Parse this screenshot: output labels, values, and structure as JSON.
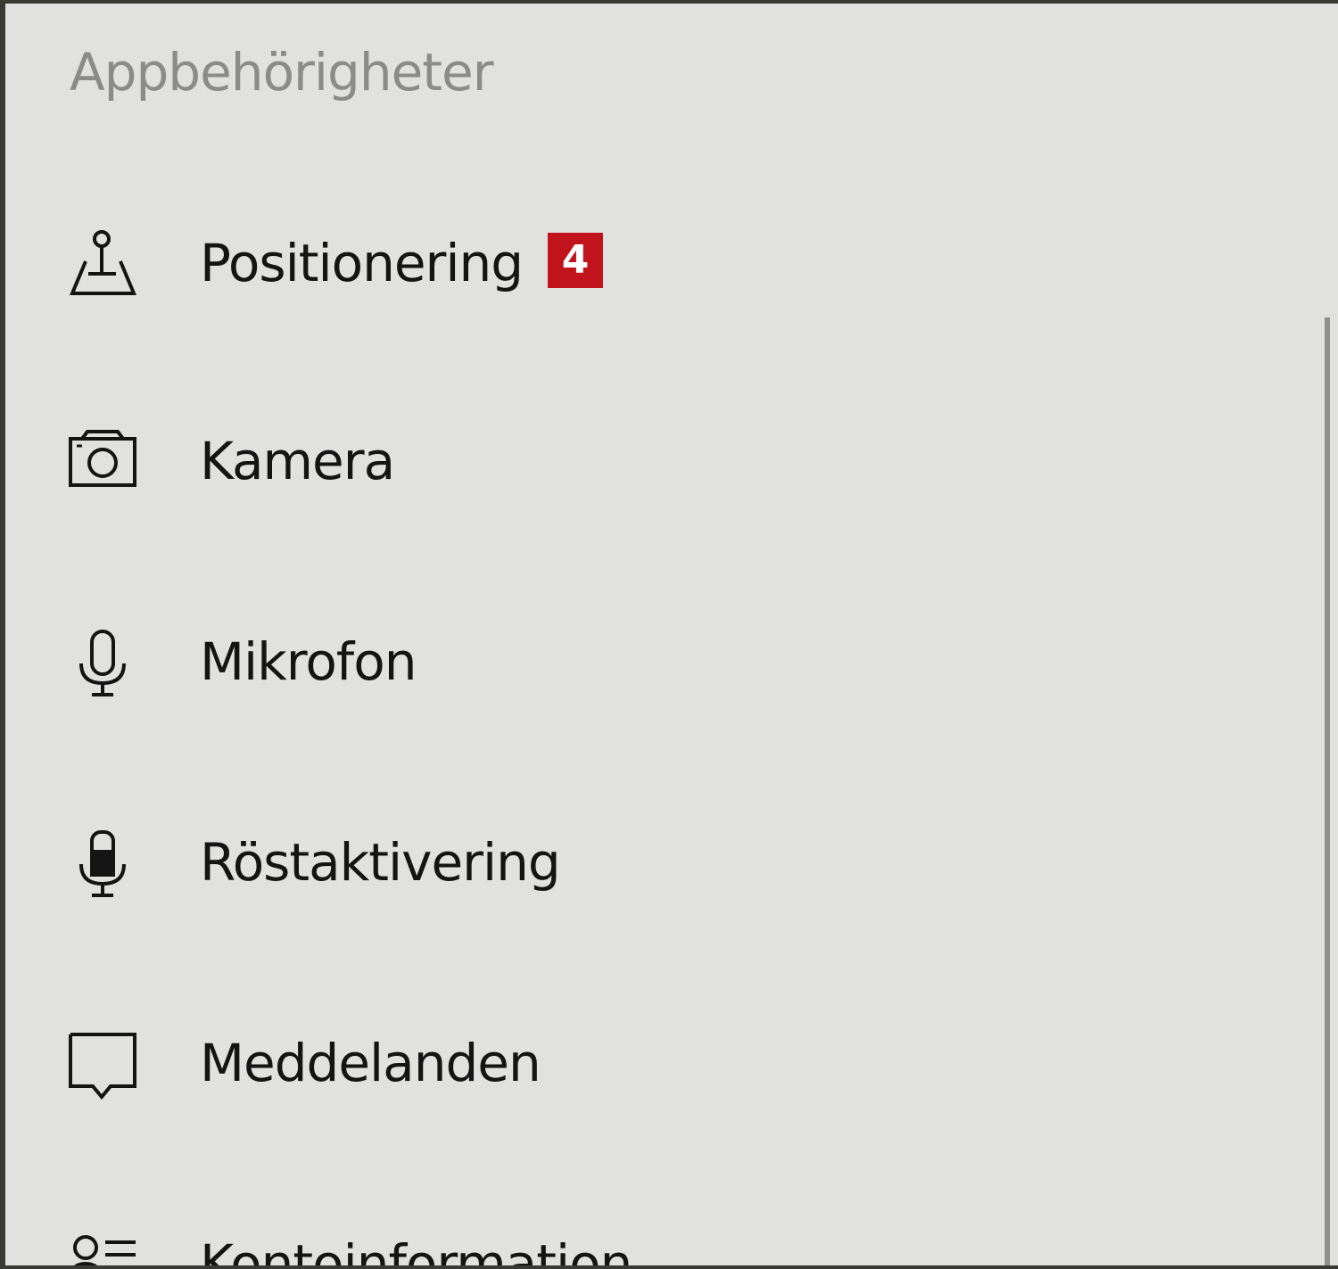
{
  "header": {
    "title": "Appbehörigheter"
  },
  "items": [
    {
      "label": "Positionering",
      "icon": "location-icon"
    },
    {
      "label": "Kamera",
      "icon": "camera-icon"
    },
    {
      "label": "Mikrofon",
      "icon": "microphone-icon"
    },
    {
      "label": "Röstaktivering",
      "icon": "voice-activation-icon"
    },
    {
      "label": "Meddelanden",
      "icon": "message-icon"
    },
    {
      "label": "Kontoinformation",
      "icon": "account-info-icon"
    }
  ],
  "badge": {
    "value": "4",
    "color": "#c1131c"
  },
  "colors": {
    "background": "#e1e2df",
    "heading": "#8b8b8b",
    "text": "#141414"
  }
}
